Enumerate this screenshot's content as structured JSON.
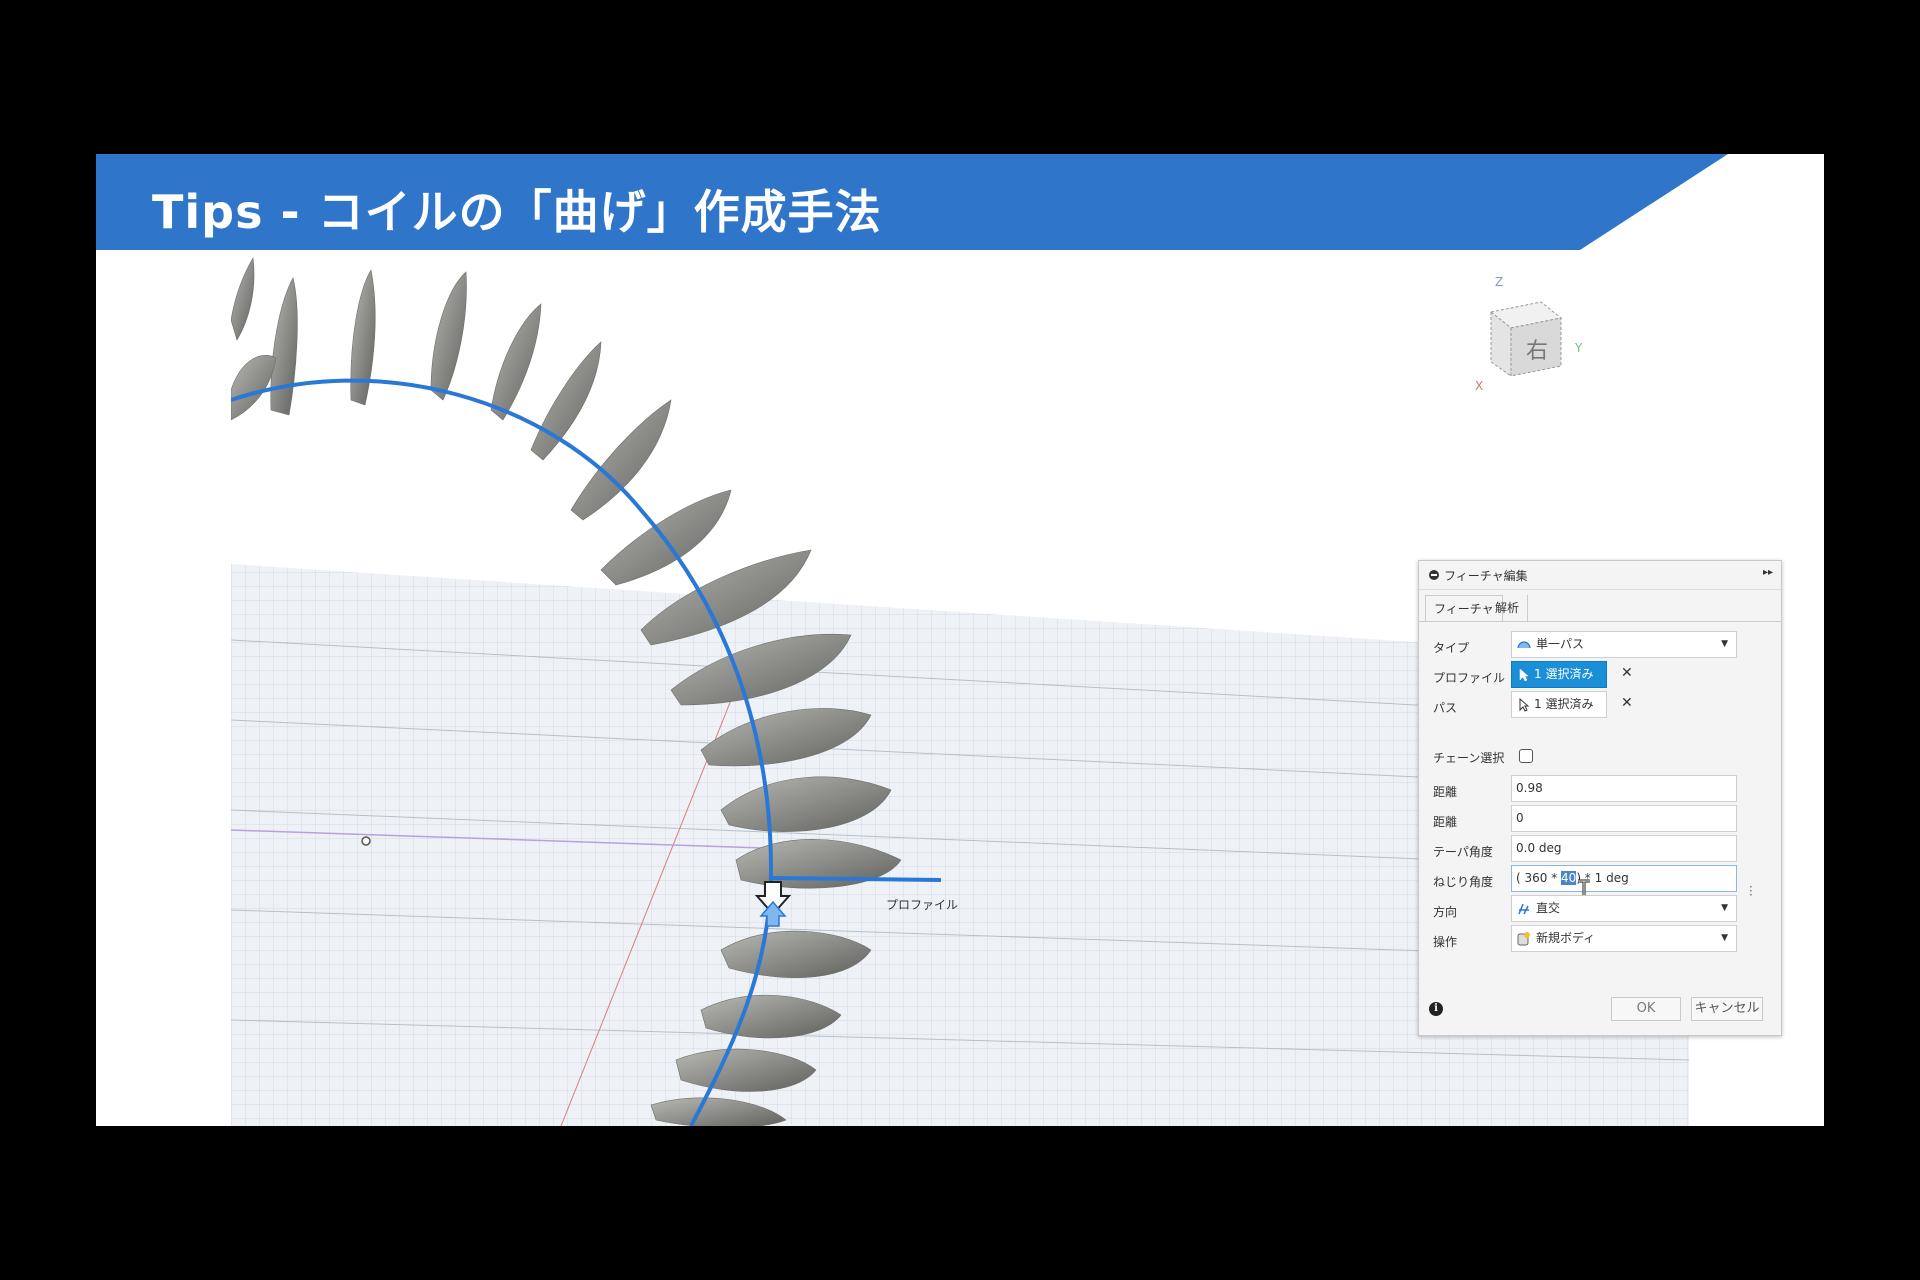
{
  "slide": {
    "title": "Tips - コイルの「曲げ」作成手法",
    "accent_color": "#2f75c9"
  },
  "viewport": {
    "view_cube_face": "右",
    "axis_labels": {
      "z": "Z",
      "x": "X",
      "y": "Y"
    },
    "profile_label": "プロファイル"
  },
  "dialog": {
    "title": "フィーチャ編集",
    "tabs": [
      "フィーチャ",
      "解析"
    ],
    "rows": {
      "type": {
        "label": "タイプ",
        "value": "単一パス"
      },
      "profile": {
        "label": "プロファイル",
        "value": "1 選択済み"
      },
      "path": {
        "label": "パス",
        "value": "1 選択済み"
      },
      "chain": {
        "label": "チェーン選択",
        "checked": false
      },
      "distance1": {
        "label": "距離",
        "value": "0.98"
      },
      "distance2": {
        "label": "距離",
        "value": "0"
      },
      "taper": {
        "label": "テーパ角度",
        "value": "0.0 deg"
      },
      "twist": {
        "label": "ねじり角度",
        "prefix": "( 360 * ",
        "selected": "40",
        "suffix": ") * 1 deg"
      },
      "direction": {
        "label": "方向",
        "value": "直交"
      },
      "operation": {
        "label": "操作",
        "value": "新規ボディ"
      }
    },
    "ok_label": "OK",
    "cancel_label": "キャンセル"
  },
  "icons": [
    "minus-circle-icon",
    "expand-arrows-icon",
    "path-type-icon",
    "cursor-icon",
    "close-icon",
    "checkbox-icon",
    "direction-icon",
    "new-body-icon",
    "info-icon",
    "text-cursor-icon",
    "view-cube-icon",
    "move-arrow-icon"
  ]
}
